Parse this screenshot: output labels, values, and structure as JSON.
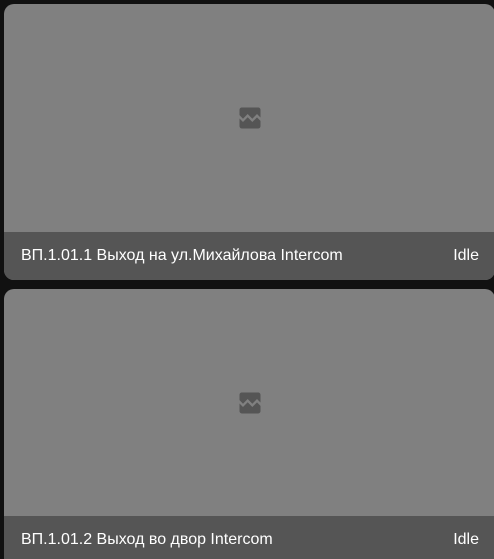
{
  "cameras": [
    {
      "name": "ВП.1.01.1 Выход на ул.Михайлова Intercom",
      "state": "Idle",
      "icon": "image-broken-icon"
    },
    {
      "name": "ВП.1.01.2 Выход во двор Intercom",
      "state": "Idle",
      "icon": "image-broken-icon"
    }
  ],
  "colors": {
    "page_background": "#111111",
    "card_background": "#808080",
    "footer_background": "#555555",
    "icon_color": "#555555",
    "text_color": "#ffffff"
  }
}
